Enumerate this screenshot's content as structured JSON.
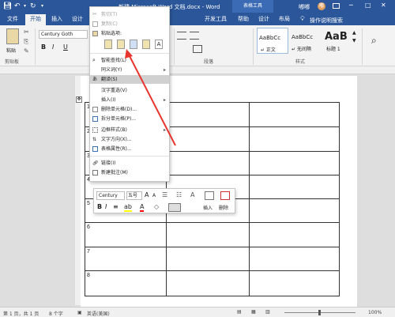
{
  "titlebar": {
    "doc_title": "新建 Microsoft Word 文档.docx - Word",
    "context_tab": "表格工具",
    "user": "嘟嘟",
    "user_avatar": "嘟",
    "ribbon_display_icon": "ribbon-display-icon",
    "win_min": "─",
    "win_max": "□",
    "win_close": "✕"
  },
  "tabs": {
    "file": "文件",
    "home": "开始",
    "insert": "插入",
    "design": "设计",
    "dev": "开发工具",
    "help": "帮助",
    "design2": "设计",
    "layout": "布局",
    "search_placeholder": "操作说明搜索"
  },
  "ribbon": {
    "paste_label": "粘贴",
    "clipboard_label": "剪贴板",
    "font_name": "Century Goth",
    "font_size": "五号",
    "bold": "B",
    "italic": "I",
    "underline": "U",
    "paragraph_label": "段落",
    "styles_label": "样式",
    "styles": [
      {
        "preview": "AaBbCc",
        "name": "↵ 正文"
      },
      {
        "preview": "AaBbCc",
        "name": "↵ 无间隔"
      },
      {
        "preview": "AaB",
        "name": "标题 1"
      }
    ],
    "edit_icon": "search-icon"
  },
  "context_menu": {
    "items": [
      {
        "label": "剪切(T)",
        "disabled": true
      },
      {
        "label": "复制(C)",
        "disabled": true
      },
      {
        "label": "粘贴选项:",
        "disabled": false
      },
      {
        "label": "智能查找(L)",
        "disabled": false
      },
      {
        "label": "同义词(Y)",
        "disabled": false
      },
      {
        "label": "翻译(S)",
        "disabled": false
      },
      {
        "label": "汉字重选(V)",
        "disabled": false
      },
      {
        "label": "插入(I)",
        "disabled": false
      },
      {
        "label": "删除单元格(D)...",
        "disabled": false
      },
      {
        "label": "拆分单元格(P)...",
        "disabled": false
      },
      {
        "label": "边框样式(B)",
        "disabled": false
      },
      {
        "label": "文字方向(X)...",
        "disabled": false
      },
      {
        "label": "表格属性(R)...",
        "disabled": false
      },
      {
        "label": "链接(I)",
        "disabled": false
      },
      {
        "label": "新建批注(M)",
        "disabled": false
      }
    ]
  },
  "mini_toolbar": {
    "font": "Century",
    "size": "五号",
    "grow": "A",
    "shrink": "A",
    "bold": "B",
    "italic": "I",
    "insert_label": "插入",
    "delete_label": "删除"
  },
  "table": {
    "row_numbers": [
      "1",
      "2",
      "3",
      "4",
      "5",
      "6",
      "7",
      "8"
    ]
  },
  "status": {
    "page": "第 1 页，共 1 页",
    "words": "8 个字",
    "lang": "英语(美国)",
    "zoom": "100%"
  },
  "colors": {
    "brand": "#2b579a",
    "arrow": "#e8362f",
    "highlight": "#ffff00",
    "font_color": "#ff0000"
  }
}
